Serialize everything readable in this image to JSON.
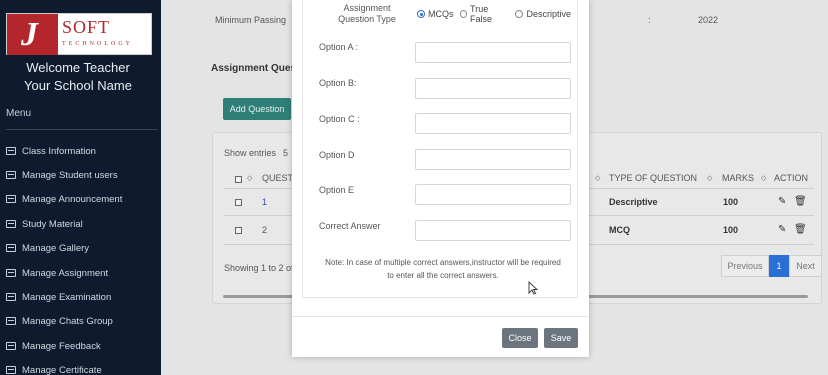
{
  "sidebar": {
    "logo": {
      "letter": "J",
      "soft": "SOFT",
      "tech": "TECHNOLOGY"
    },
    "welcome": "Welcome Teacher",
    "school": "Your School Name",
    "menu_label": "Menu",
    "items": [
      {
        "label": "Class Information",
        "icon": "list-icon"
      },
      {
        "label": "Manage Student users",
        "icon": "list-icon"
      },
      {
        "label": "Manage Announcement",
        "icon": "list-icon"
      },
      {
        "label": "Study Material",
        "icon": "list-icon"
      },
      {
        "label": "Manage Gallery",
        "icon": "list-icon"
      },
      {
        "label": "Manage Assignment",
        "icon": "list-icon"
      },
      {
        "label": "Manage Examination",
        "icon": "list-icon"
      },
      {
        "label": "Manage Chats Group",
        "icon": "list-icon"
      },
      {
        "label": "Manage Feedback",
        "icon": "list-icon"
      },
      {
        "label": "Manage Certificate",
        "icon": "list-icon"
      }
    ]
  },
  "background": {
    "min_passing_label": "Minimum Passing",
    "colon": ":",
    "year_value": "2022",
    "section_title": "Assignment Ques",
    "add_button": "Add Question",
    "show_entries": "Show entries",
    "entries_value": "5",
    "table": {
      "col_question": "QUESTI",
      "col_type": "TYPE OF QUESTION",
      "col_marks": "MARKS",
      "col_action": "ACTION",
      "rows": [
        {
          "num": "1",
          "type": "Descriptive",
          "marks": "100"
        },
        {
          "num": "2",
          "type": "MCQ",
          "marks": "100"
        }
      ]
    },
    "showing": "Showing 1 to 2 of",
    "pager": {
      "previous": "Previous",
      "page": "1",
      "next": "Next"
    }
  },
  "modal": {
    "question_type_label": "Assignment Question Type",
    "question_type_options": [
      "MCQs",
      "True False",
      "Descriptive"
    ],
    "question_type_selected": "MCQs",
    "fields": [
      {
        "label": "Option A :",
        "value": ""
      },
      {
        "label": "Option B:",
        "value": ""
      },
      {
        "label": "Option C :",
        "value": ""
      },
      {
        "label": "Option D",
        "value": ""
      },
      {
        "label": "Option E",
        "value": ""
      },
      {
        "label": "Correct Answer",
        "value": ""
      }
    ],
    "note": "Note: In case of multiple correct answers,instructor will be required to enter all the correct answers.",
    "close_button": "Close",
    "save_button": "Save"
  },
  "colors": {
    "sidebar_bg": "#0e1b2e",
    "accent_teal": "#2e7f78",
    "logo_red": "#b3262b",
    "pager_active": "#2a6fd6",
    "button_gray": "#6c757d"
  }
}
